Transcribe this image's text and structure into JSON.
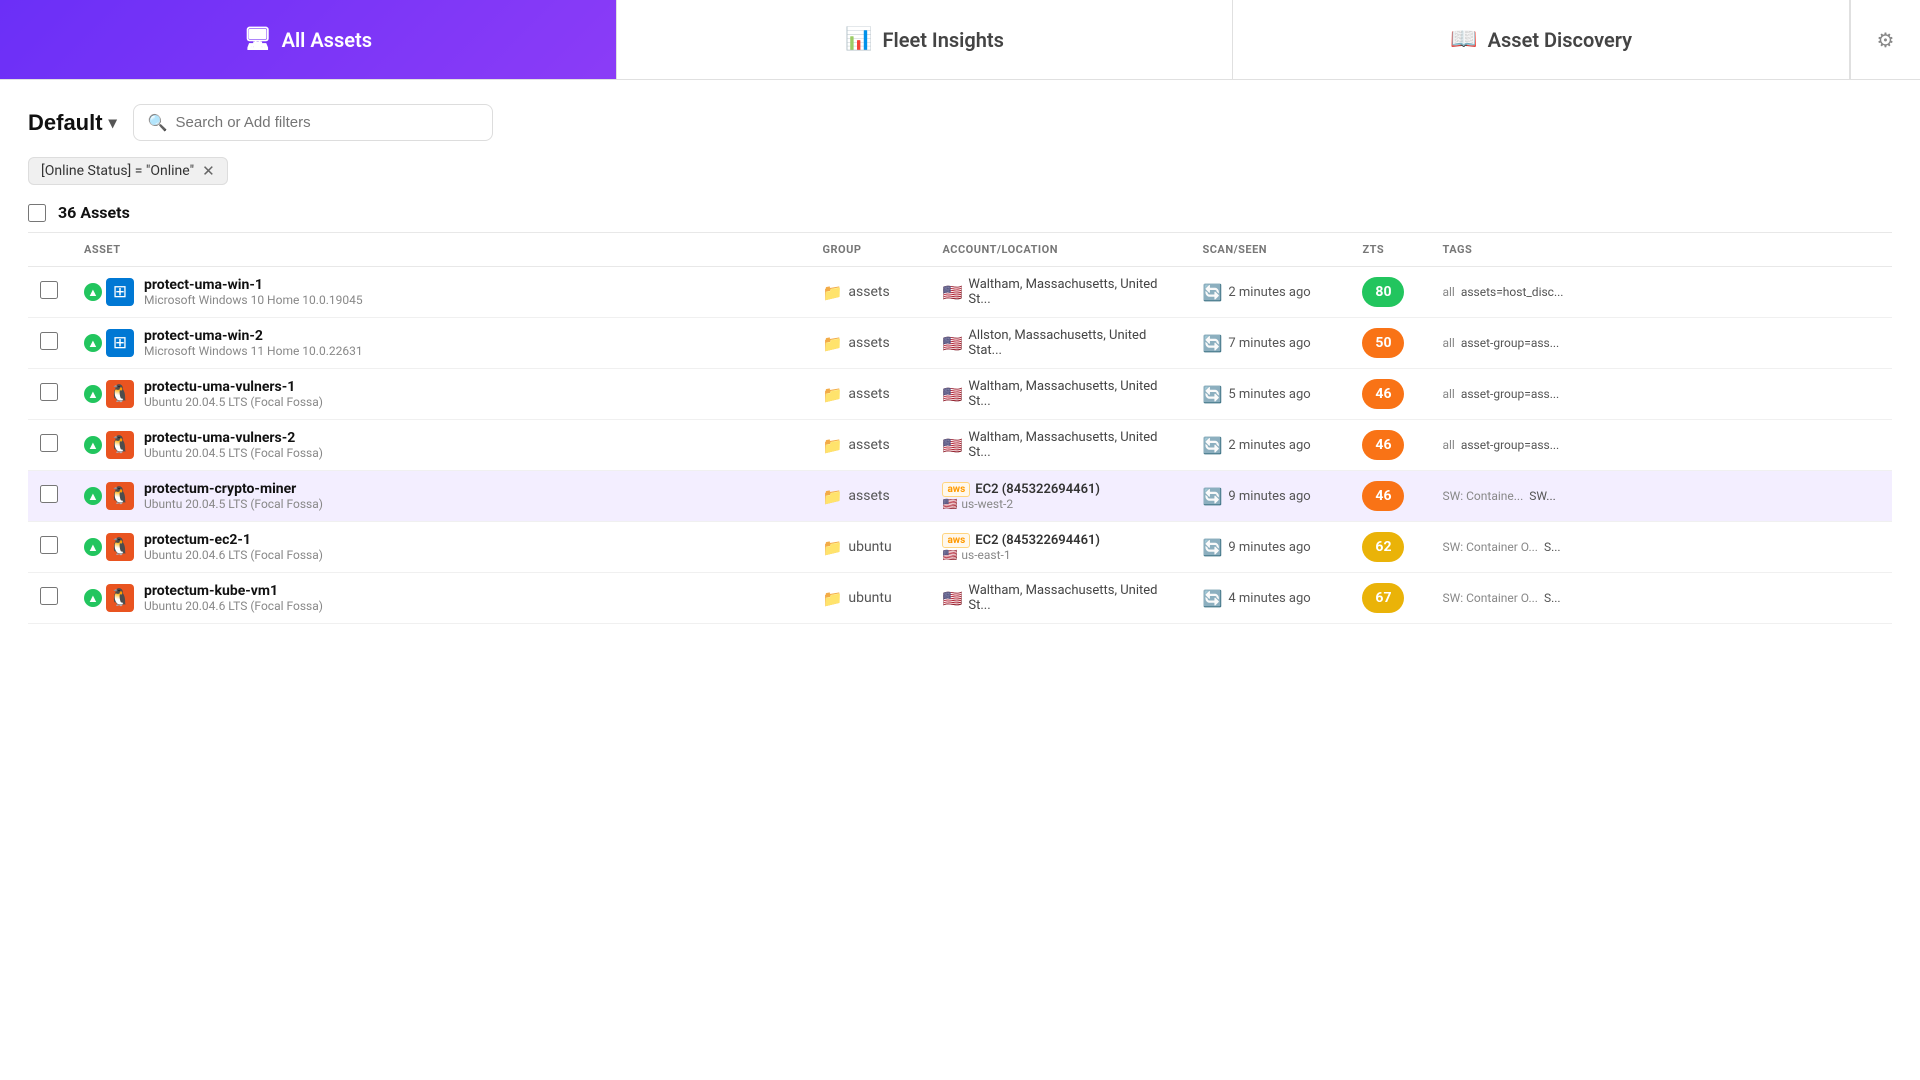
{
  "nav": {
    "tabs": [
      {
        "id": "all-assets",
        "label": "All Assets",
        "icon": "🖥",
        "active": true
      },
      {
        "id": "fleet-insights",
        "label": "Fleet Insights",
        "icon": "📊",
        "active": false
      },
      {
        "id": "asset-discovery",
        "label": "Asset Discovery",
        "icon": "📖",
        "active": false
      }
    ],
    "extra_icon": "⚙"
  },
  "filter": {
    "default_label": "Default",
    "search_placeholder": "Search or Add filters",
    "active_filter": "[Online Status] = \"Online\""
  },
  "asset_count": "36 Assets",
  "columns": [
    {
      "id": "asset",
      "label": "ASSET"
    },
    {
      "id": "group",
      "label": "GROUP"
    },
    {
      "id": "location",
      "label": "ACCOUNT/LOCATION"
    },
    {
      "id": "scan",
      "label": "SCAN/SEEN"
    },
    {
      "id": "zts",
      "label": "ZTS"
    },
    {
      "id": "tags",
      "label": "TAGS"
    }
  ],
  "rows": [
    {
      "id": "row-1",
      "name": "protect-uma-win-1",
      "sub": "Microsoft Windows 10 Home 10.0.19045",
      "os": "windows",
      "group": "assets",
      "location_type": "plain",
      "location": "Waltham, Massachusetts, United St...",
      "scan": "2 minutes ago",
      "zts": "80",
      "zts_color": "green",
      "tags_prefix": "all",
      "tags": "assets=host_disc...",
      "highlighted": false
    },
    {
      "id": "row-2",
      "name": "protect-uma-win-2",
      "sub": "Microsoft Windows 11 Home 10.0.22631",
      "os": "windows",
      "group": "assets",
      "location_type": "plain",
      "location": "Allston, Massachusetts, United Stat...",
      "scan": "7 minutes ago",
      "zts": "50",
      "zts_color": "orange",
      "tags_prefix": "all",
      "tags": "asset-group=ass...",
      "highlighted": false
    },
    {
      "id": "row-3",
      "name": "protectu-uma-vulners-1",
      "sub": "Ubuntu 20.04.5 LTS (Focal Fossa)",
      "os": "ubuntu",
      "group": "assets",
      "location_type": "plain",
      "location": "Waltham, Massachusetts, United St...",
      "scan": "5 minutes ago",
      "zts": "46",
      "zts_color": "orange",
      "tags_prefix": "all",
      "tags": "asset-group=ass...",
      "highlighted": false
    },
    {
      "id": "row-4",
      "name": "protectu-uma-vulners-2",
      "sub": "Ubuntu 20.04.5 LTS (Focal Fossa)",
      "os": "ubuntu",
      "group": "assets",
      "location_type": "plain",
      "location": "Waltham, Massachusetts, United St...",
      "scan": "2 minutes ago",
      "zts": "46",
      "zts_color": "orange",
      "tags_prefix": "all",
      "tags": "asset-group=ass...",
      "highlighted": false
    },
    {
      "id": "row-5",
      "name": "protectum-crypto-miner",
      "sub": "Ubuntu 20.04.5 LTS (Focal Fossa)",
      "os": "ubuntu",
      "group": "assets",
      "location_type": "ec2",
      "ec2_title": "EC2 (845322694461)",
      "ec2_sub": "us-west-2",
      "scan": "9 minutes ago",
      "zts": "46",
      "zts_color": "orange",
      "tags_prefix": "SW: Containe...",
      "tags": "SW...",
      "highlighted": true
    },
    {
      "id": "row-6",
      "name": "protectum-ec2-1",
      "sub": "Ubuntu 20.04.6 LTS (Focal Fossa)",
      "os": "ubuntu",
      "group": "ubuntu",
      "location_type": "ec2",
      "ec2_title": "EC2 (845322694461)",
      "ec2_sub": "us-east-1",
      "scan": "9 minutes ago",
      "zts": "62",
      "zts_color": "yellow",
      "tags_prefix": "SW: Container O...",
      "tags": "S...",
      "highlighted": false
    },
    {
      "id": "row-7",
      "name": "protectum-kube-vm1",
      "sub": "Ubuntu 20.04.6 LTS (Focal Fossa)",
      "os": "ubuntu",
      "group": "ubuntu",
      "location_type": "plain",
      "location": "Waltham, Massachusetts, United St...",
      "scan": "4 minutes ago",
      "zts": "67",
      "zts_color": "yellow",
      "tags_prefix": "SW: Container O...",
      "tags": "S...",
      "highlighted": false
    }
  ]
}
